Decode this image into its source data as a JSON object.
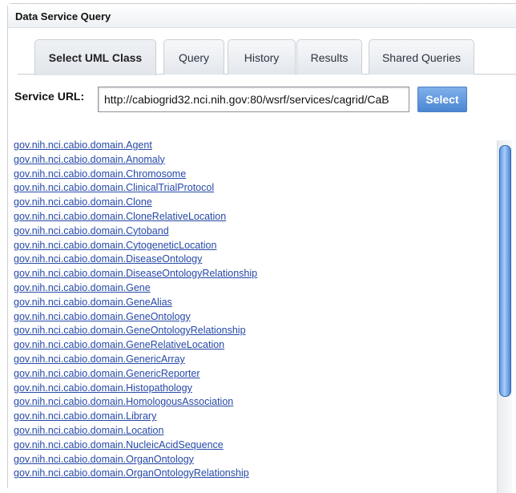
{
  "panel": {
    "title": "Data Service Query"
  },
  "tabs": [
    {
      "label": "Select UML Class",
      "active": true
    },
    {
      "label": "Query"
    },
    {
      "label": "History"
    },
    {
      "label": "Results"
    },
    {
      "label": "Shared Queries"
    }
  ],
  "service": {
    "label": "Service URL:",
    "url": "http://cabiogrid32.nci.nih.gov:80/wsrf/services/cagrid/CaB",
    "select_label": "Select"
  },
  "classes": [
    "gov.nih.nci.cabio.domain.Agent",
    "gov.nih.nci.cabio.domain.Anomaly",
    "gov.nih.nci.cabio.domain.Chromosome",
    "gov.nih.nci.cabio.domain.ClinicalTrialProtocol",
    "gov.nih.nci.cabio.domain.Clone",
    "gov.nih.nci.cabio.domain.CloneRelativeLocation",
    "gov.nih.nci.cabio.domain.Cytoband",
    "gov.nih.nci.cabio.domain.CytogeneticLocation",
    "gov.nih.nci.cabio.domain.DiseaseOntology",
    "gov.nih.nci.cabio.domain.DiseaseOntologyRelationship",
    "gov.nih.nci.cabio.domain.Gene",
    "gov.nih.nci.cabio.domain.GeneAlias",
    "gov.nih.nci.cabio.domain.GeneOntology",
    "gov.nih.nci.cabio.domain.GeneOntologyRelationship",
    "gov.nih.nci.cabio.domain.GeneRelativeLocation",
    "gov.nih.nci.cabio.domain.GenericArray",
    "gov.nih.nci.cabio.domain.GenericReporter",
    "gov.nih.nci.cabio.domain.Histopathology",
    "gov.nih.nci.cabio.domain.HomologousAssociation",
    "gov.nih.nci.cabio.domain.Library",
    "gov.nih.nci.cabio.domain.Location",
    "gov.nih.nci.cabio.domain.NucleicAcidSequence",
    "gov.nih.nci.cabio.domain.OrganOntology",
    "gov.nih.nci.cabio.domain.OrganOntologyRelationship"
  ]
}
